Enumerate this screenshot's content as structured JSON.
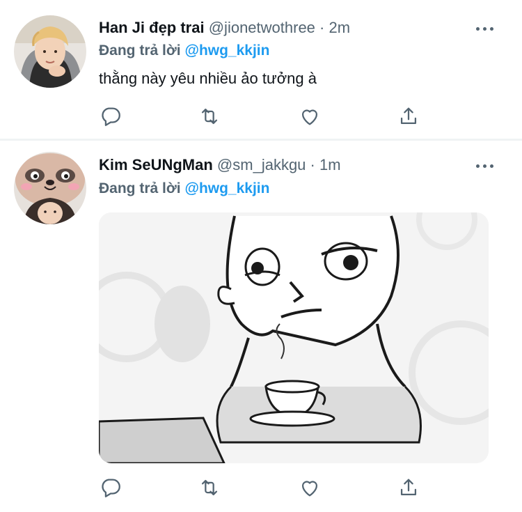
{
  "tweets": [
    {
      "display_name": "Han Ji đẹp trai",
      "handle": "@jionetwothree",
      "separator": "·",
      "time": "2m",
      "reply_prefix": "Đang trả lời",
      "reply_to": "@hwg_kkjin",
      "text": "thằng này yêu nhiều ảo tưởng à",
      "avatar": "avatar-photo-boy-hoodie",
      "actions": [
        "reply-icon",
        "retweet-icon",
        "like-icon",
        "share-icon"
      ]
    },
    {
      "display_name": "Kim SeUNgMan",
      "handle": "@sm_jakkgu",
      "separator": "·",
      "time": "1m",
      "reply_prefix": "Đang trả lời",
      "reply_to": "@hwg_kkjin",
      "media": "sketch-man-drinking-coffee",
      "avatar": "avatar-photo-boy-animal-hat",
      "actions": [
        "reply-icon",
        "retweet-icon",
        "like-icon",
        "share-icon"
      ]
    }
  ],
  "colors": {
    "link": "#1d9bf0",
    "secondary_text": "#536471",
    "primary_text": "#0f1419",
    "divider": "#eff3f4"
  }
}
